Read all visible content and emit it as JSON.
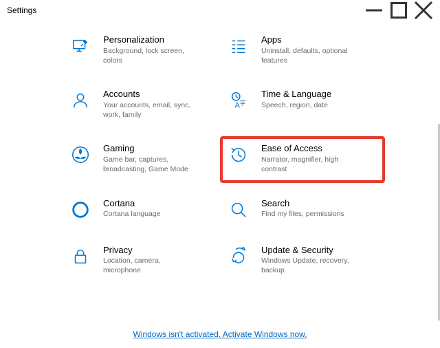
{
  "window": {
    "title": "Settings"
  },
  "tiles": [
    {
      "name": "Personalization",
      "desc": "Background, lock screen, colors",
      "icon": "personalization"
    },
    {
      "name": "Apps",
      "desc": "Uninstall, defaults, optional features",
      "icon": "apps"
    },
    {
      "name": "Accounts",
      "desc": "Your accounts, email, sync, work, family",
      "icon": "accounts"
    },
    {
      "name": "Time & Language",
      "desc": "Speech, region, date",
      "icon": "time-language"
    },
    {
      "name": "Gaming",
      "desc": "Game bar, captures, broadcasting, Game Mode",
      "icon": "gaming"
    },
    {
      "name": "Ease of Access",
      "desc": "Narrator, magnifier, high contrast",
      "icon": "ease-of-access",
      "highlight": true
    },
    {
      "name": "Cortana",
      "desc": "Cortana language",
      "icon": "cortana"
    },
    {
      "name": "Search",
      "desc": "Find my files, permissions",
      "icon": "search"
    },
    {
      "name": "Privacy",
      "desc": "Location, camera, microphone",
      "icon": "privacy"
    },
    {
      "name": "Update & Security",
      "desc": "Windows Update, recovery, backup",
      "icon": "update-security"
    }
  ],
  "activation_link": "Windows isn't activated. Activate Windows now."
}
